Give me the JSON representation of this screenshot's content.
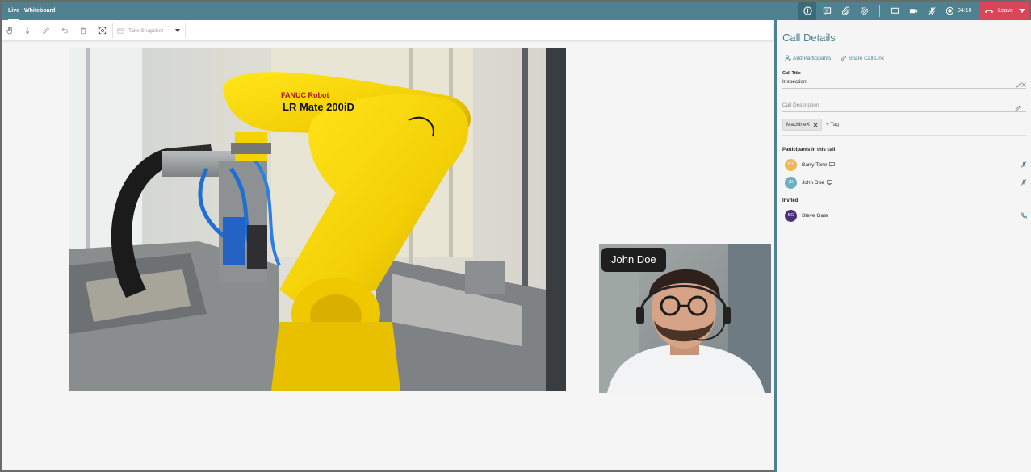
{
  "tabs": [
    {
      "label": "Live",
      "active": true
    },
    {
      "label": "Whiteboard",
      "active": false
    }
  ],
  "header_icons": [
    "info-icon",
    "chat-icon",
    "attachment-icon",
    "settings-icon",
    "screen-share-icon",
    "camera-icon",
    "mic-muted-icon",
    "record-icon"
  ],
  "timer": "04:10",
  "leave_label": "Leave",
  "toolbar": {
    "tools": [
      "hand-icon",
      "arrow-down-icon",
      "pen-icon",
      "undo-icon",
      "trash-icon",
      "focus-icon"
    ],
    "snapshot_label": "Take Snapshot"
  },
  "stage": {
    "shared_image": "robot-arm-image",
    "robot_label_brand": "FANUC Robot",
    "robot_label_model": "LR Mate 200iD",
    "video_tile_name": "John Doe"
  },
  "panel": {
    "title": "Call Details",
    "add_participants": "Add Participants",
    "share_link": "Share Call Link",
    "call_title_label": "Call Title",
    "call_title_value": "Inspection",
    "call_description_placeholder": "Call Description",
    "tags": [
      "MachineX"
    ],
    "add_tag": "+ Tag",
    "participants_heading": "Participants in this call",
    "participants": [
      {
        "initials": "BT",
        "name": "Barry Tone",
        "color": "#efb94c",
        "device": "chat-bubble-icon"
      },
      {
        "initials": "JD",
        "name": "John Doe",
        "color": "#6aaec2",
        "device": "monitor-icon"
      }
    ],
    "invited_heading": "Invited",
    "invited": [
      {
        "initials": "SG",
        "name": "Steve Gate",
        "color": "#4b2f7d"
      }
    ]
  },
  "colors": {
    "brand_teal": "#4e8290",
    "leave_red": "#d9465a",
    "background": "#f5f5f5"
  }
}
